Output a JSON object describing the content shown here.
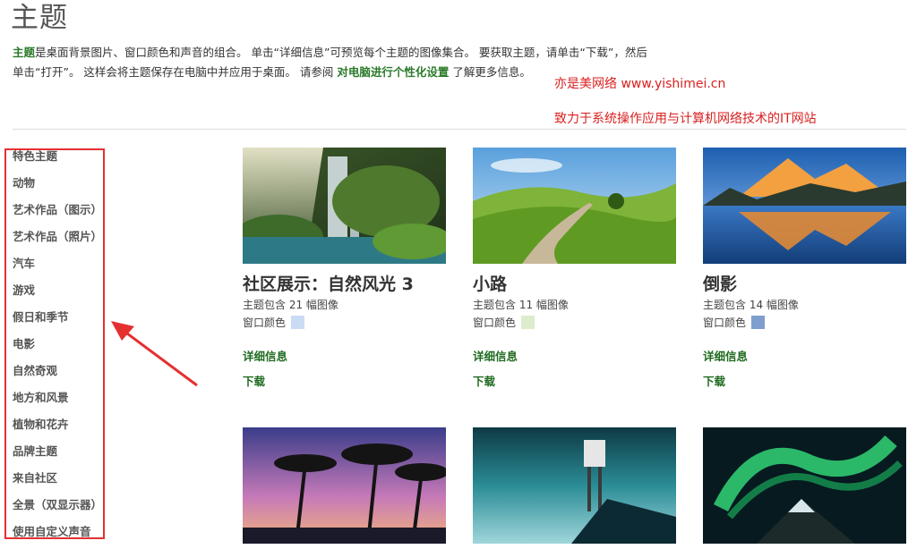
{
  "page": {
    "title": "主题"
  },
  "intro": {
    "lead": "主题",
    "line1_rest": "是桌面背景图片、窗口颜色和声音的组合。 单击“详细信息”可预览每个主题的图像集合。 要获取主题，请单击“下载”，然后",
    "line2_prefix": "单击“打开”。 这样会将主题保存在电脑中并应用于桌面。 请参阅 ",
    "line2_link": "对电脑进行个性化设置",
    "line2_suffix": " 了解更多信息。"
  },
  "watermark": {
    "line1": "亦是美网络 www.yishimei.cn",
    "line2": "致力于系统操作应用与计算机网络技术的IT网站"
  },
  "sidebar": {
    "items": [
      {
        "label": "特色主题"
      },
      {
        "label": "动物"
      },
      {
        "label": "艺术作品（图示）"
      },
      {
        "label": "艺术作品（照片）"
      },
      {
        "label": "汽车"
      },
      {
        "label": "游戏"
      },
      {
        "label": "假日和季节"
      },
      {
        "label": "电影"
      },
      {
        "label": "自然奇观"
      },
      {
        "label": "地方和风景"
      },
      {
        "label": "植物和花卉"
      },
      {
        "label": "品牌主题"
      },
      {
        "label": "来自社区"
      },
      {
        "label": "全景（双显示器）"
      },
      {
        "label": "使用自定义声音"
      }
    ]
  },
  "themes": [
    {
      "title": "社区展示：自然风光 3",
      "count": "主题包含 21 幅图像",
      "color_label": "窗口颜色",
      "swatch": "#c9dcf3",
      "details": "详细信息",
      "download": "下载",
      "image": "waterfall-photo"
    },
    {
      "title": "小路",
      "count": "主题包含 11 幅图像",
      "color_label": "窗口颜色",
      "swatch": "#dceccc",
      "details": "详细信息",
      "download": "下载",
      "image": "path-photo"
    },
    {
      "title": "倒影",
      "count": "主题包含 14 幅图像",
      "color_label": "窗口颜色",
      "swatch": "#7f9ecd",
      "details": "详细信息",
      "download": "下载",
      "image": "reflection-photo"
    },
    {
      "image": "palm-sunset-photo"
    },
    {
      "image": "lifeguard-tower-photo"
    },
    {
      "image": "aurora-photo"
    }
  ],
  "colors": {
    "link_green": "#1f6b1f",
    "highlight_red": "#e53030",
    "watermark_red": "#d92020"
  }
}
